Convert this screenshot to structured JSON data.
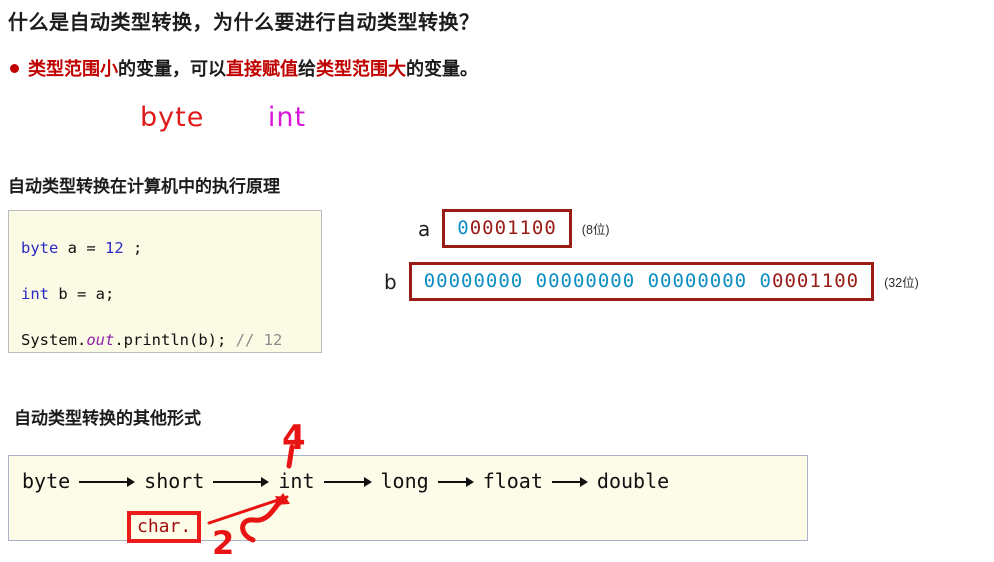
{
  "slide": {
    "title": "什么是自动类型转换，为什么要进行自动类型转换？",
    "bullet": {
      "part1": "类型范围小",
      "part2": "的变量，可以",
      "part3": "直接赋值",
      "part4": "给",
      "part5": "类型范围大",
      "part6": "的变量。"
    },
    "handwriting_types": {
      "small": "byte",
      "large": "int"
    },
    "section_heading_1": "自动类型转换在计算机中的执行原理",
    "section_heading_2": "自动类型转换的其他形式"
  },
  "code_block": {
    "line1": {
      "keyword": "byte",
      "rest": " a = ",
      "value": "12",
      "tail": " ;"
    },
    "line2": {
      "keyword": "int",
      "rest": " b = a;"
    },
    "line3": {
      "prefix": "System.",
      "field": "out",
      "call": ".println(b); ",
      "comment": "// 12"
    }
  },
  "memory": {
    "row_a": {
      "var": "a",
      "bits_low": "0",
      "bits_high": "0001100",
      "note": "(8位)"
    },
    "row_b": {
      "var": "b",
      "bits_low": "00000000 00000000 00000000 0",
      "bits_high": "0001100",
      "note": "(32位)"
    }
  },
  "conversion_chain": {
    "items": [
      "byte",
      "short",
      "int",
      "long",
      "float",
      "double"
    ],
    "annotations": {
      "char_label": "char.",
      "num_above_int": "4",
      "num_below_char": "2"
    }
  },
  "colors": {
    "accent_red": "#c00000",
    "hand_red": "#e81414",
    "hand_magenta": "#d916d9",
    "bit_blue": "#0f8ec4",
    "bit_darkred": "#9a1c16",
    "code_keyword_blue": "#2b2bc4",
    "code_field_purple": "#8e24aa",
    "code_comment_gray": "#8c8c8c",
    "code_bg": "#fbfae4",
    "chain_bg": "#fdfce8"
  }
}
